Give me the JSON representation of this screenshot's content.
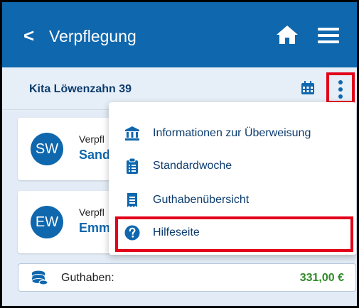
{
  "header": {
    "back_glyph": "<",
    "title": "Verpflegung",
    "home_icon": "home-icon",
    "menu_icon": "hamburger-menu-icon"
  },
  "subheader": {
    "kita": "Kita Löwenzahn 39",
    "calendar_icon": "calendar-icon",
    "more_icon": "kebab-menu-icon"
  },
  "children": [
    {
      "initials": "SW",
      "meta": "Verpfl",
      "name": "Sand"
    },
    {
      "initials": "EW",
      "meta": "Verpfl",
      "name": "Emm"
    }
  ],
  "balance": {
    "label": "Guthaben:",
    "value": "331,00 €"
  },
  "menu": {
    "items": [
      {
        "label": "Informationen zur Überweisung",
        "icon": "bank-icon"
      },
      {
        "label": "Standardwoche",
        "icon": "clipboard-list-icon"
      },
      {
        "label": "Guthabenübersicht",
        "icon": "receipt-icon"
      },
      {
        "label": "Hilfeseite",
        "icon": "question-circle-icon"
      }
    ]
  },
  "colors": {
    "primary": "#0f67ad",
    "highlight": "#e2001a",
    "balance_value": "#2e8b27"
  }
}
